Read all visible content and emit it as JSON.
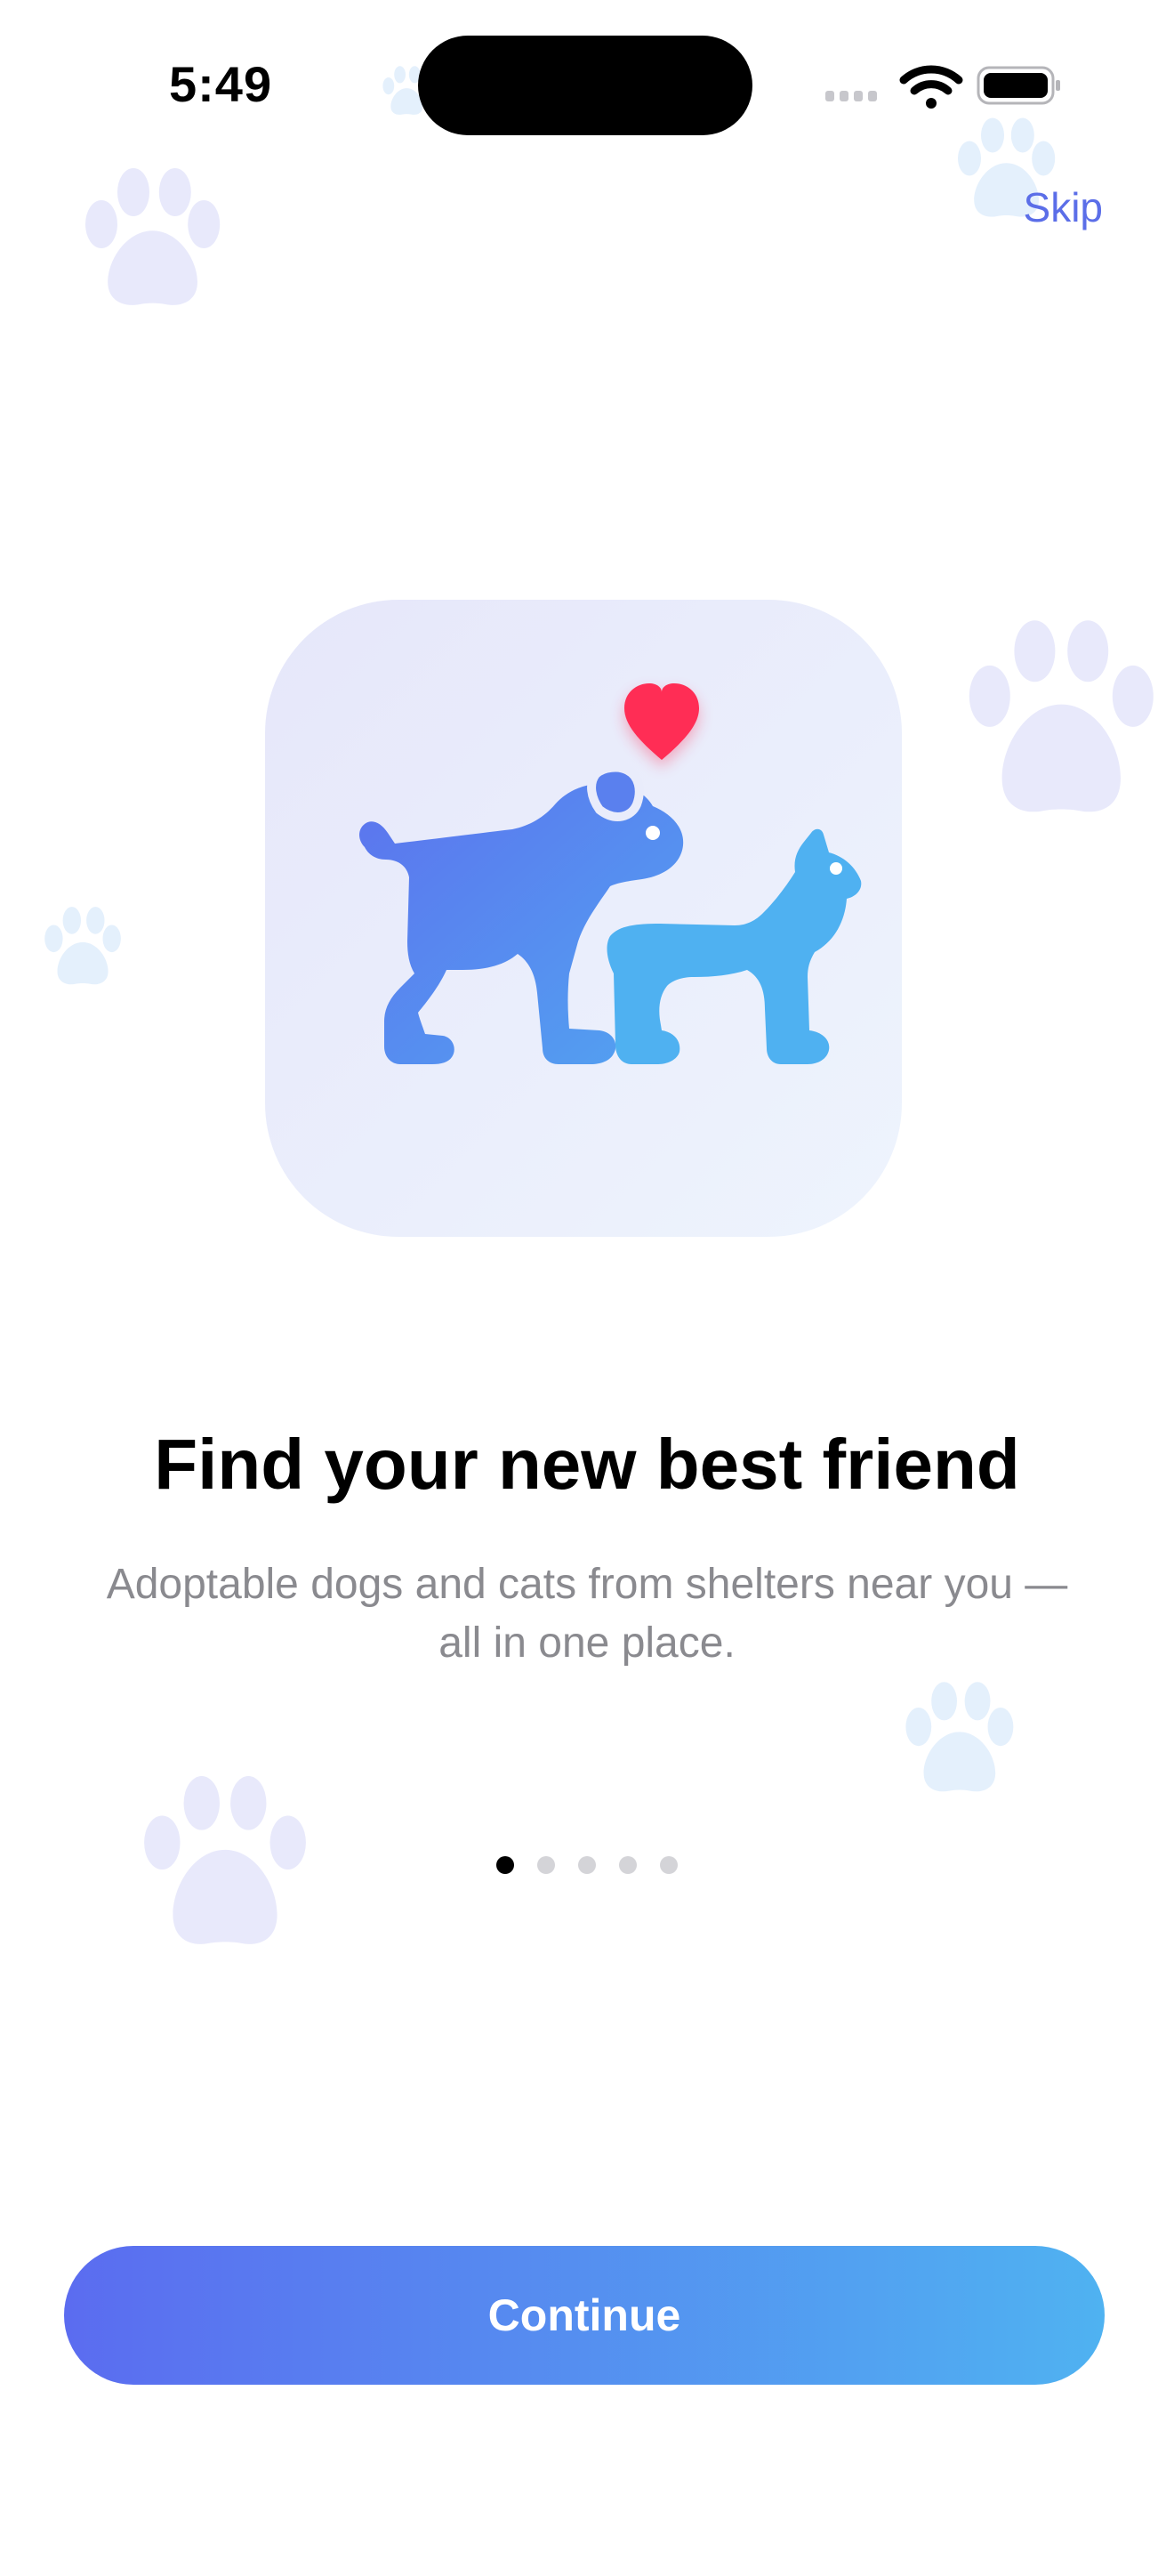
{
  "status_bar": {
    "time": "5:49"
  },
  "header": {
    "skip_label": "Skip"
  },
  "onboarding": {
    "title": "Find your new best friend",
    "subtitle": "Adoptable dogs and cats from shelters near you — all in one place.",
    "illustration_icon": "dog-and-cat-icon",
    "heart_icon": "heart-icon",
    "page_count": 5,
    "current_page": 1
  },
  "footer": {
    "continue_label": "Continue"
  },
  "colors": {
    "accent": "#5b6ee8",
    "heart": "#ff2d55",
    "gradient_start": "#5b6cf0",
    "gradient_end": "#4fb2f1"
  }
}
